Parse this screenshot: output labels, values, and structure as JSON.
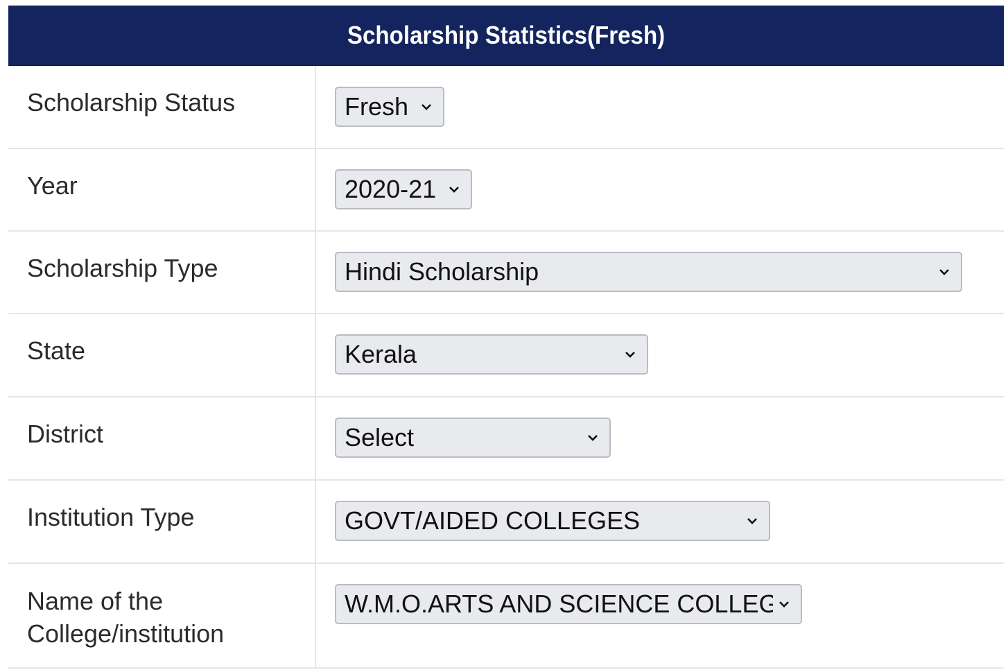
{
  "header": {
    "title": "Scholarship Statistics(Fresh)"
  },
  "form": {
    "rows": [
      {
        "label": "Scholarship Status",
        "value": "Fresh"
      },
      {
        "label": "Year",
        "value": "2020-21"
      },
      {
        "label": "Scholarship Type",
        "value": "Hindi Scholarship"
      },
      {
        "label": "State",
        "value": "Kerala"
      },
      {
        "label": "District",
        "value": "Select"
      },
      {
        "label": "Institution Type",
        "value": "GOVT/AIDED COLLEGES"
      },
      {
        "label": "Name of the College/institution",
        "value": "W.M.O.ARTS AND SCIENCE COLLEGE"
      }
    ]
  },
  "colors": {
    "header_bg": "#13245e",
    "select_bg": "#e9eaee",
    "row_border": "#e4e6ea"
  },
  "icons": {
    "dropdown": "chevron-down-icon"
  }
}
